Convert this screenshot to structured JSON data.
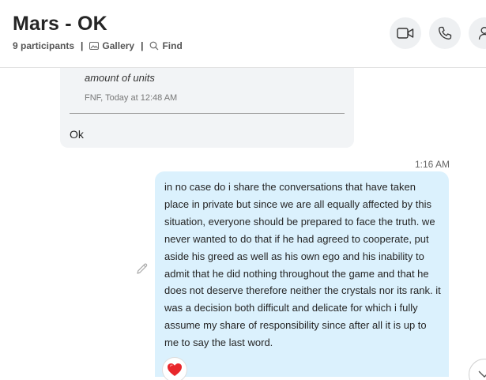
{
  "header": {
    "title": "Mars - OK",
    "participants": "9 participants",
    "separator": "|",
    "gallery_label": "Gallery",
    "find_label": "Find",
    "buttons": [
      "video-call-icon",
      "audio-call-icon",
      "add-person-icon"
    ]
  },
  "messages": {
    "quoted": {
      "text": "amount of units",
      "meta": "FNF, Today at 12:48 AM"
    },
    "incoming_reply": "Ok",
    "outgoing_time": "1:16 AM",
    "outgoing_text": "in no case do i share the conversations that have taken place in private but since we are all equally affected by this situation, everyone should be prepared to face the truth. we never wanted to do that if he had agreed to cooperate, put aside his greed as well as his own ego and his inability to admit that he did nothing throughout the game and that he does not deserve therefore neither the crystals nor its rank. it was a decision both difficult and delicate for which i fully assume my share of responsibility since after all it is up to me to say the last word.",
    "reaction": "heart-icon"
  },
  "colors": {
    "outgoing_bubble": "#dbf1fd",
    "incoming_bubble": "#f2f4f6",
    "reaction": "#e8262b"
  }
}
